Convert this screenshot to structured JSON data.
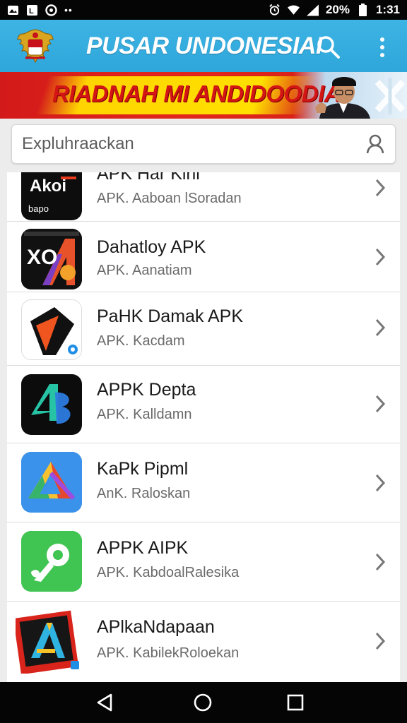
{
  "status_bar": {
    "battery_text": "20%",
    "time": "1:31",
    "icons": [
      "photo-icon",
      "notification-icon",
      "sync-icon",
      "dots-icon",
      "alarm-icon",
      "wifi-icon",
      "signal-icon",
      "battery-icon"
    ]
  },
  "app_bar": {
    "title": "PUSAR UNDONESIAI",
    "icons": [
      "emblem-logo",
      "search-icon",
      "more-vert-icon"
    ]
  },
  "banner": {
    "text": "RIADNAH MI ANDIDOODIA"
  },
  "search": {
    "placeholder": "Expluhraackan"
  },
  "list": {
    "items": [
      {
        "icon_label": "Akoi",
        "icon_sub": "bapo",
        "title": "APK Har Kiril",
        "subtitle": "APK. Aaboan lSoradan"
      },
      {
        "icon_label": "XO",
        "title": "Dahatloy APK",
        "subtitle": "APK. Aanatiam"
      },
      {
        "title": "PaHK Damak APK",
        "subtitle": "APK. Kacdam"
      },
      {
        "title": "APPK Depta",
        "subtitle": "APK. Kalldamn"
      },
      {
        "title": "KaPk Pipml",
        "subtitle": "AnK. Raloskan"
      },
      {
        "title": "APPK AIPK",
        "subtitle": "APK. KabdoalRalesika"
      },
      {
        "title": "APlkaNdapaan",
        "subtitle": "APK. KabilekRoloekan"
      }
    ]
  },
  "nav_bar": {
    "icons": [
      "back-icon",
      "home-icon",
      "recents-icon"
    ]
  },
  "colors": {
    "app_bar": "#35ade0",
    "banner_red": "#d92319",
    "banner_yellow": "#ffd400",
    "status_bar": "#050505"
  }
}
